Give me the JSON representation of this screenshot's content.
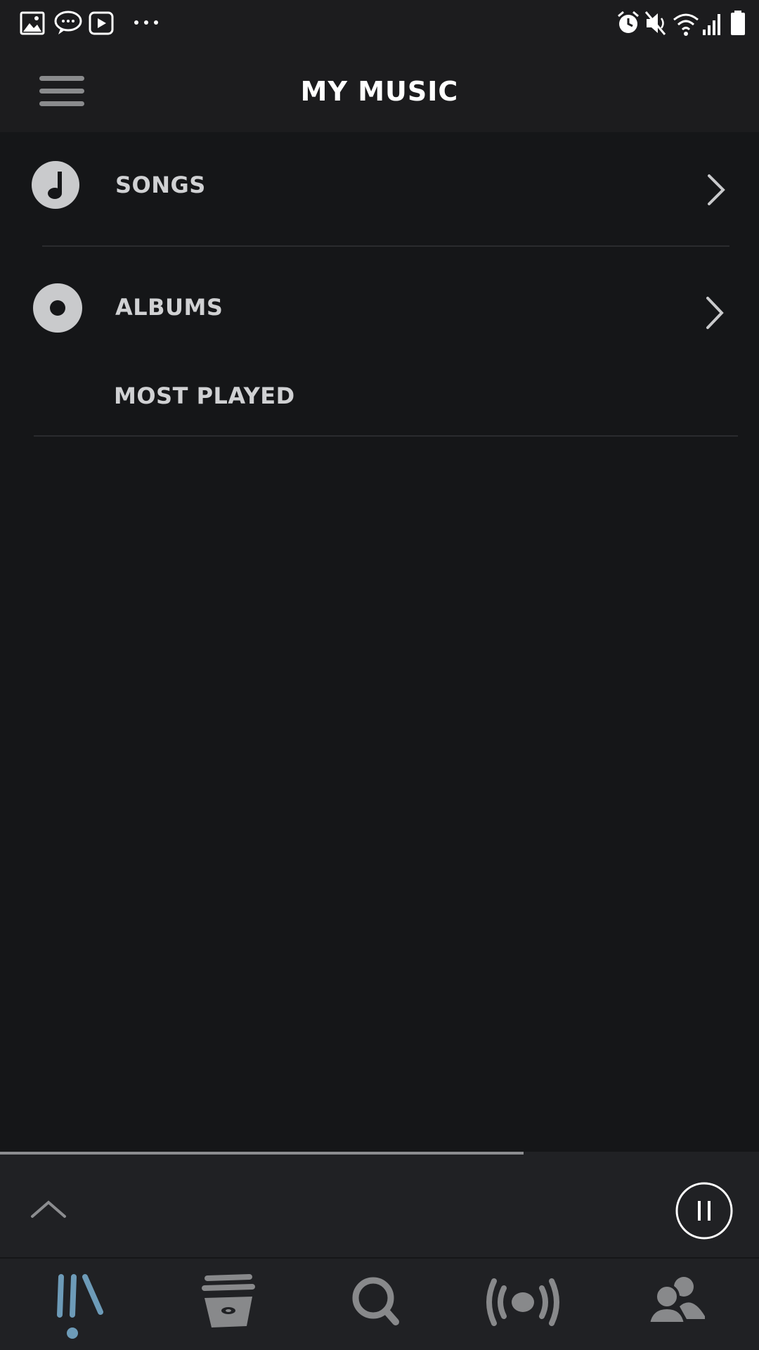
{
  "status_bar": {
    "left_icons": [
      "gallery-icon",
      "chat-icon",
      "video-icon",
      "more-dots-icon"
    ],
    "right_icons": [
      "alarm-icon",
      "mute-icon",
      "wifi-icon",
      "signal-icon",
      "battery-icon"
    ]
  },
  "header": {
    "title": "MY MUSIC",
    "menu_icon": "hamburger-icon"
  },
  "list": {
    "items": [
      {
        "label": "SONGS",
        "icon": "music-note-icon"
      },
      {
        "label": "ALBUMS",
        "icon": "album-icon"
      },
      {
        "label": "MOST PLAYED"
      }
    ]
  },
  "player": {
    "progress": 0.69,
    "expand_icon": "chevron-up-icon",
    "pause_icon": "pause-icon"
  },
  "tabs": [
    {
      "icon": "library-icon",
      "active": true
    },
    {
      "icon": "browse-icon",
      "active": false
    },
    {
      "icon": "search-icon",
      "active": false
    },
    {
      "icon": "radio-icon",
      "active": false
    },
    {
      "icon": "friends-icon",
      "active": false
    }
  ],
  "colors": {
    "background": "#151618",
    "header": "#1c1c1e",
    "active_tab": "#6d9bb8",
    "inactive_tab": "#88898b"
  }
}
